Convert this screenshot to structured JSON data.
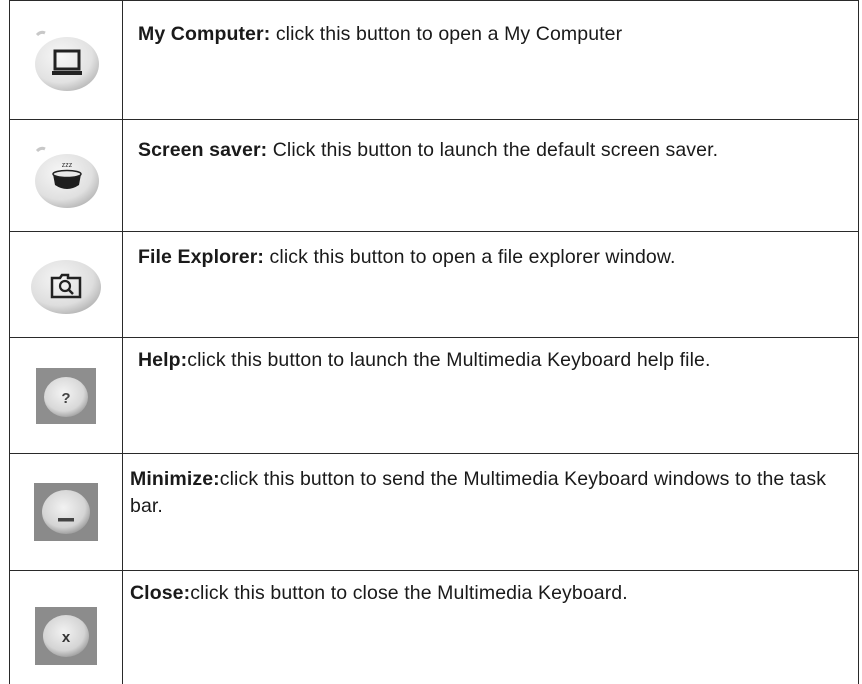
{
  "rows": [
    {
      "title": "My Computer:",
      "description": " click this button to open a My Computer",
      "icon": "my-computer-icon"
    },
    {
      "title": "Screen saver:",
      "description": " Click this button to launch the default screen saver.",
      "icon": "screen-saver-icon"
    },
    {
      "title": "File Explorer:",
      "description": " click this button to open a file explorer window.",
      "icon": "file-explorer-icon"
    },
    {
      "title": "Help:",
      "description": "click this button to launch the Multimedia Keyboard help file.",
      "icon": "help-icon"
    },
    {
      "title": "Minimize:",
      "description": "click this button to send the Multimedia Keyboard windows to the task bar.",
      "icon": "minimize-icon"
    },
    {
      "title": "Close:",
      "description": "click this button to close the Multimedia Keyboard.",
      "icon": "close-icon"
    }
  ],
  "colors": {
    "border": "#2a2a2a",
    "text": "#1a1a1a",
    "button_light": "#e4e4e4",
    "button_dark": "#9a9a9a"
  }
}
